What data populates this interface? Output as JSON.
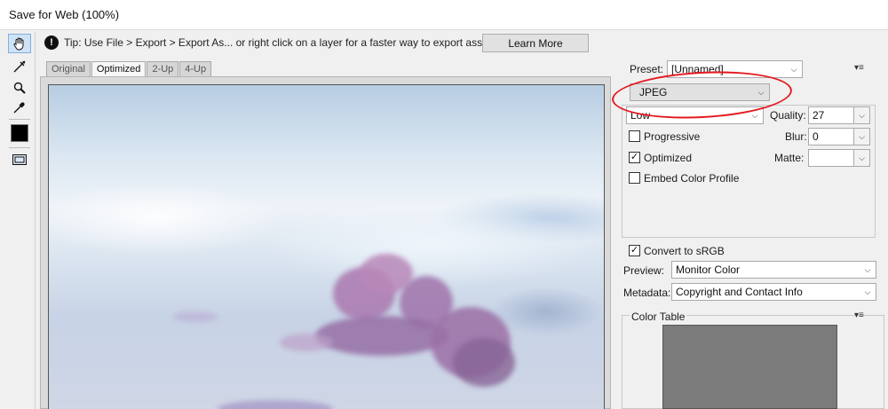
{
  "window": {
    "title": "Save for Web (100%)"
  },
  "tools": [
    {
      "name": "hand-tool-icon"
    },
    {
      "name": "slice-select-tool-icon"
    },
    {
      "name": "zoom-tool-icon"
    },
    {
      "name": "eyedropper-tool-icon"
    }
  ],
  "tip": {
    "icon": "tip-icon",
    "text": "Tip: Use File > Export > Export As...  or right click on a layer for a faster way to export assets",
    "button_label": "Learn More"
  },
  "view_tabs": [
    {
      "label": "Original",
      "active": false
    },
    {
      "label": "Optimized",
      "active": true
    },
    {
      "label": "2-Up",
      "active": false
    },
    {
      "label": "4-Up",
      "active": false
    }
  ],
  "settings": {
    "preset_label": "Preset:",
    "preset_value": "[Unnamed]",
    "format_value": "JPEG",
    "quality_level_value": "Low",
    "quality_label": "Quality:",
    "quality_value": "27",
    "blur_label": "Blur:",
    "blur_value": "0",
    "matte_label": "Matte:",
    "matte_value": "",
    "progressive_label": "Progressive",
    "progressive_checked": false,
    "optimized_label": "Optimized",
    "optimized_checked": true,
    "embed_profile_label": "Embed Color Profile",
    "embed_profile_checked": false,
    "convert_srgb_label": "Convert to sRGB",
    "convert_srgb_checked": true,
    "preview_label": "Preview:",
    "preview_value": "Monitor Color",
    "metadata_label": "Metadata:",
    "metadata_value": "Copyright and Contact Info"
  },
  "color_table": {
    "title": "Color Table"
  },
  "colors": {
    "highlight": "#e3191f",
    "active_tool_bg": "#cfe3f7"
  }
}
